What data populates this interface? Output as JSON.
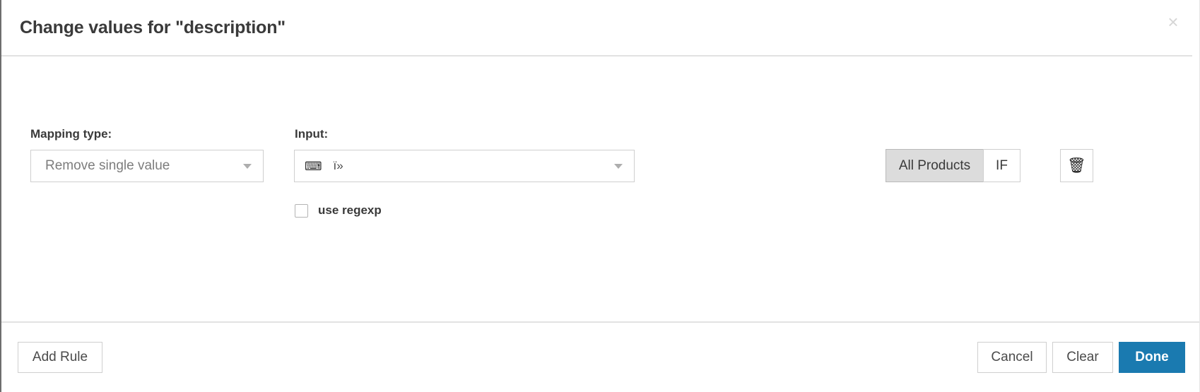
{
  "dialog": {
    "title": "Change values for \"description\"",
    "close_icon": "close-icon",
    "close_glyph": "×"
  },
  "rule": {
    "mapping": {
      "label": "Mapping type:",
      "selected": "Remove single value",
      "caret_icon": "chevron-down-icon"
    },
    "input": {
      "label": "Input:",
      "keyboard_icon": "keyboard-icon",
      "keyboard_glyph": "⌨",
      "value": "ï»",
      "placeholder": ""
    },
    "regexp": {
      "label": "use regexp",
      "checked": false
    },
    "scope": {
      "all_products_label": "All Products",
      "if_label": "IF",
      "selected": "All Products"
    },
    "delete": {
      "icon": "trash-icon",
      "glyph": "🗑"
    }
  },
  "footer": {
    "add_rule_label": "Add Rule",
    "cancel_label": "Cancel",
    "clear_label": "Clear",
    "done_label": "Done"
  },
  "colors": {
    "primary": "#1a7ab0",
    "border": "#cfcfcf",
    "toggle_active_bg": "#dcdcdc",
    "text": "#3a3a3a",
    "muted_text": "#7d7d7d"
  }
}
